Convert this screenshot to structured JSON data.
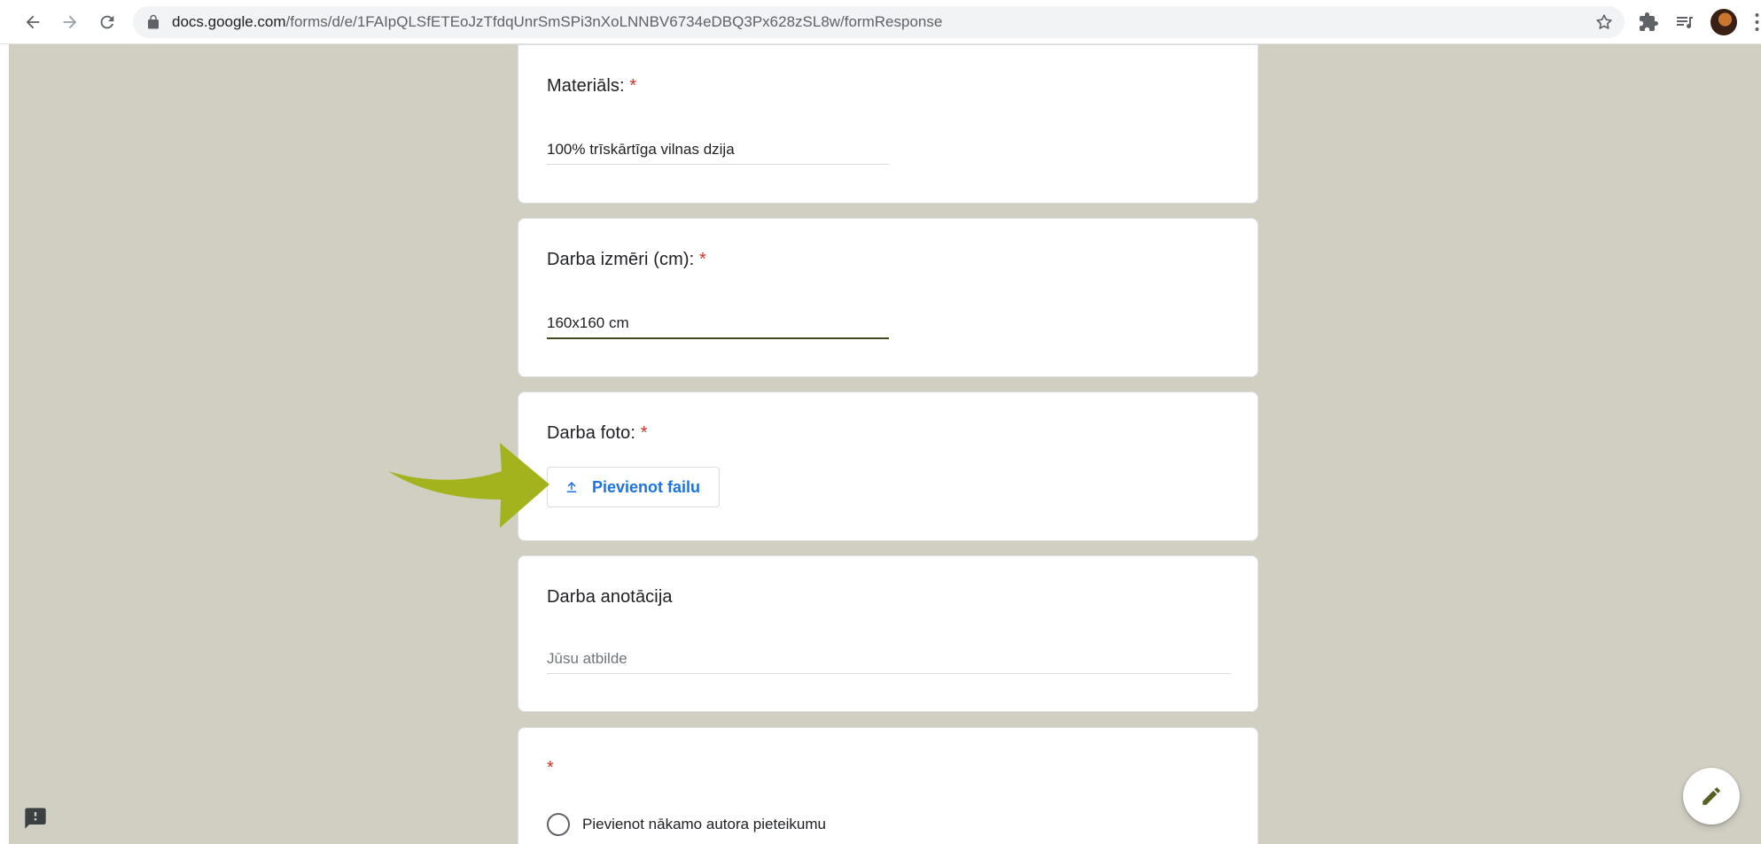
{
  "browser": {
    "url_host": "docs.google.com",
    "url_path": "/forms/d/e/1FAIpQLSfETEoJzTfdqUnrSmSPi3nXoLNNBV6734eDBQ3Px628zSL8w/formResponse"
  },
  "form": {
    "materials": {
      "label": "Materiāls:",
      "required": "*",
      "value": "100% trīskārtīga vilnas dzija"
    },
    "dimensions": {
      "label": "Darba izmēri (cm):",
      "required": "*",
      "value": "160x160 cm"
    },
    "photo": {
      "label": "Darba foto:",
      "required": "*",
      "upload_label": "Pievienot failu"
    },
    "annotation": {
      "label": "Darba anotācija",
      "placeholder": "Jūsu atbilde"
    },
    "next_author": {
      "required": "*",
      "option_label": "Pievienot nākamo autora pieteikumu"
    }
  },
  "colors": {
    "page_background": "#d0cfc2",
    "accent_underline": "#414a1f",
    "required_star": "#d93025",
    "link_blue": "#1a73e8",
    "annotation_arrow": "#a3b31d"
  },
  "icons": {
    "back": "arrow-left-icon",
    "forward": "arrow-right-icon",
    "reload": "reload-icon",
    "lock": "lock-icon",
    "bookmark": "star-icon",
    "extensions": "puzzle-icon",
    "media": "playlist-icon",
    "upload": "upload-icon",
    "report": "feedback-icon",
    "edit": "pencil-icon"
  }
}
